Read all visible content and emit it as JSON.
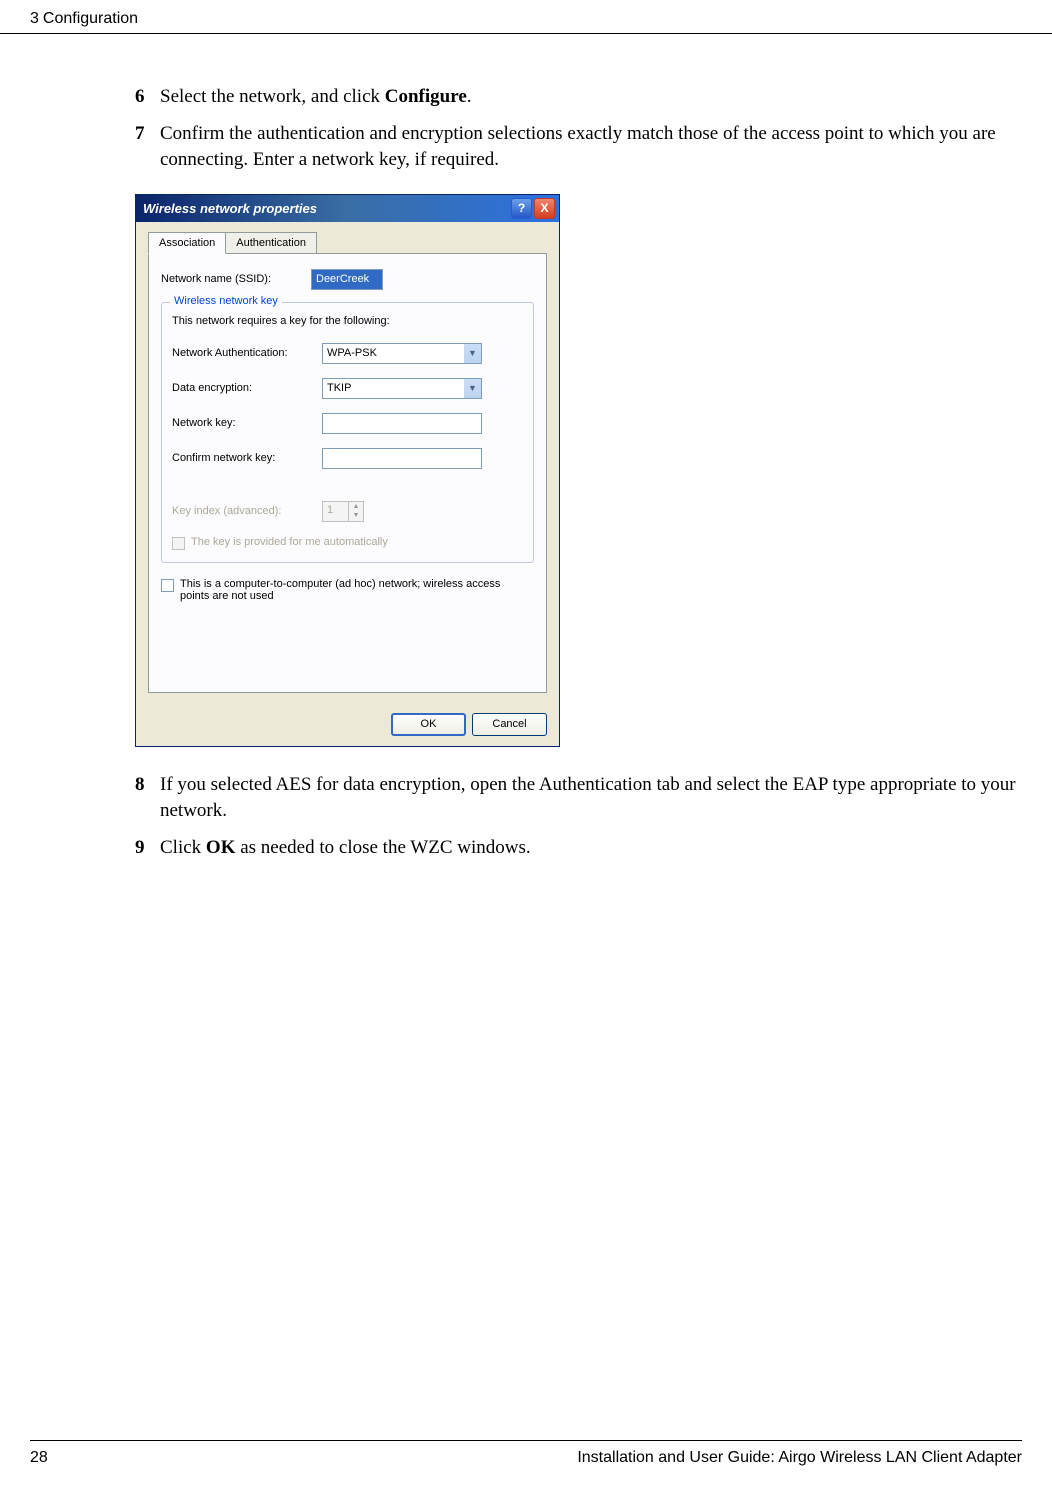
{
  "header": {
    "chapter_num": "3",
    "chapter_title": "Configuration"
  },
  "steps": {
    "s6": {
      "num": "6",
      "text_pre": "Select the network, and click ",
      "bold": "Configure",
      "text_post": "."
    },
    "s7": {
      "num": "7",
      "text": "Confirm the authentication and encryption selections exactly match those of the access point to which you are connecting. Enter a network key, if required."
    },
    "s8": {
      "num": "8",
      "text": "If you selected AES for data encryption, open the Authentication tab and select the EAP type appropriate to your network."
    },
    "s9": {
      "num": "9",
      "text_pre": "Click ",
      "bold": "OK",
      "text_post": " as needed to close the WZC windows."
    }
  },
  "dialog": {
    "title": "Wireless network properties",
    "help_glyph": "?",
    "close_glyph": "X",
    "tab_association": "Association",
    "tab_authentication": "Authentication",
    "ssid_label": "Network name (SSID):",
    "ssid_value": "DeerCreek",
    "fieldset_legend": "Wireless network key",
    "fieldset_text": "This network requires a key for the following:",
    "auth_label": "Network Authentication:",
    "auth_value": "WPA-PSK",
    "encrypt_label": "Data encryption:",
    "encrypt_value": "TKIP",
    "netkey_label": "Network key:",
    "confirm_label": "Confirm network key:",
    "keyidx_label": "Key index (advanced):",
    "keyidx_value": "1",
    "auto_checkbox": "The key is provided for me automatically",
    "adhoc_text": "This is a computer-to-computer (ad hoc) network; wireless access points are not used",
    "ok_btn": "OK",
    "cancel_btn": "Cancel"
  },
  "footer": {
    "page_num": "28",
    "doc_title": "Installation and User Guide: Airgo Wireless LAN Client Adapter"
  }
}
